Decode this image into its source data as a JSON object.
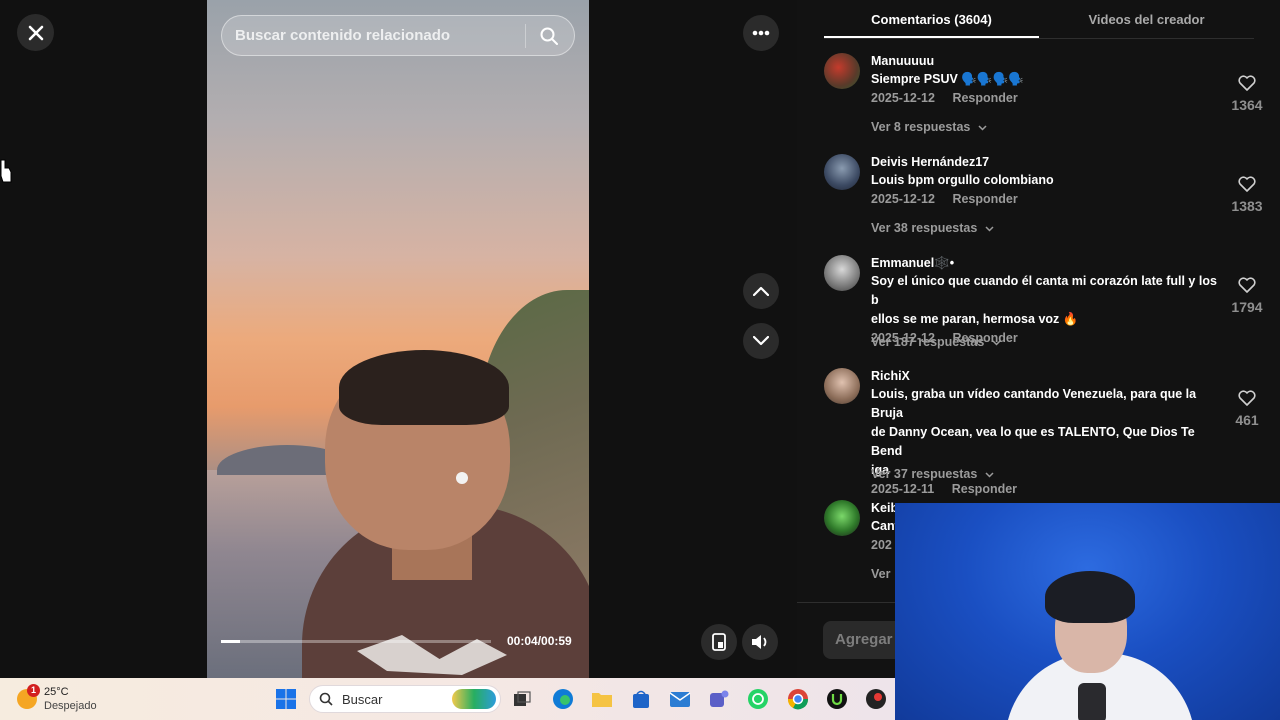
{
  "search": {
    "placeholder": "Buscar contenido relacionado"
  },
  "player": {
    "timecode": "00:04/00:59",
    "progress": 0.07
  },
  "tabs": [
    {
      "label": "Comentarios (3604)",
      "active": true
    },
    {
      "label": "Videos del creador",
      "active": false
    }
  ],
  "comments": [
    {
      "user": "Manuuuuu",
      "text": "Siempre PSUV 🗣️🗣️🗣️🗣️",
      "date": "2025-12-12",
      "reply": "Responder",
      "replies": "Ver 8 respuestas",
      "likes": "1364"
    },
    {
      "user": "Deivis Hernández17",
      "text": "Louis bpm orgullo colombiano",
      "date": "2025-12-12",
      "reply": "Responder",
      "replies": "Ver 38 respuestas",
      "likes": "1383"
    },
    {
      "user": "Emmanuel🕸️•",
      "text": "Soy el único que cuando él canta mi corazón late full y los b",
      "text2": "ellos se me paran, hermosa voz 🔥",
      "date": "2025-12-12",
      "reply": "Responder",
      "replies": "Ver 187 respuestas",
      "likes": "1794"
    },
    {
      "user": "RichiX",
      "text": "Louis, graba un vídeo cantando Venezuela, para que la Bruja",
      "text2": "de Danny Ocean, vea lo que es TALENTO, Que Dios Te Bend",
      "text3": "iga",
      "date": "2025-12-11",
      "reply": "Responder",
      "replies": "Ver 37 respuestas",
      "likes": "461"
    },
    {
      "user": "Keib",
      "text": "Cant",
      "date": "202",
      "replies": "Ver"
    }
  ],
  "add_comment": {
    "placeholder": "Agregar c"
  },
  "taskbar": {
    "weather_temp": "25°C",
    "weather_cond": "Despejado",
    "weather_badge": "1",
    "search_label": "Buscar"
  },
  "colors": {
    "background": "#121212",
    "accent": "#fe2c55",
    "muted": "#9b9b9b"
  },
  "icons": [
    "close-icon",
    "search-icon",
    "more-icon",
    "chevron-up-icon",
    "chevron-down-icon",
    "pip-icon",
    "volume-icon",
    "heart-icon"
  ]
}
